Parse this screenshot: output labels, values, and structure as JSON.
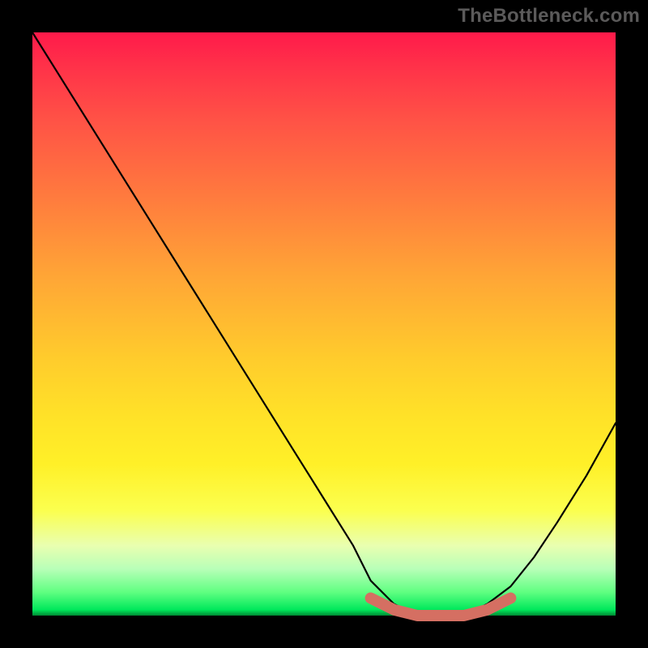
{
  "watermark": "TheBottleneck.com",
  "chart_data": {
    "type": "line",
    "title": "",
    "xlabel": "",
    "ylabel": "",
    "xlim": [
      0,
      100
    ],
    "ylim": [
      0,
      100
    ],
    "grid": false,
    "series": [
      {
        "name": "curve",
        "x": [
          0,
          5,
          10,
          15,
          20,
          25,
          30,
          35,
          40,
          45,
          50,
          55,
          58,
          62,
          66,
          70,
          74,
          78,
          82,
          86,
          90,
          95,
          100
        ],
        "values": [
          100,
          92,
          84,
          76,
          68,
          60,
          52,
          44,
          36,
          28,
          20,
          12,
          6,
          2,
          0,
          0,
          0,
          2,
          5,
          10,
          16,
          24,
          33
        ]
      }
    ],
    "highlight": {
      "name": "highlight-band",
      "x": [
        58,
        62,
        66,
        70,
        74,
        78,
        82
      ],
      "values": [
        3,
        1,
        0,
        0,
        0,
        1,
        3
      ],
      "color": "#d56f62"
    }
  },
  "colors": {
    "background": "#000000",
    "curve": "#000000",
    "highlight": "#d56f62",
    "watermark": "#5b5a5a"
  }
}
